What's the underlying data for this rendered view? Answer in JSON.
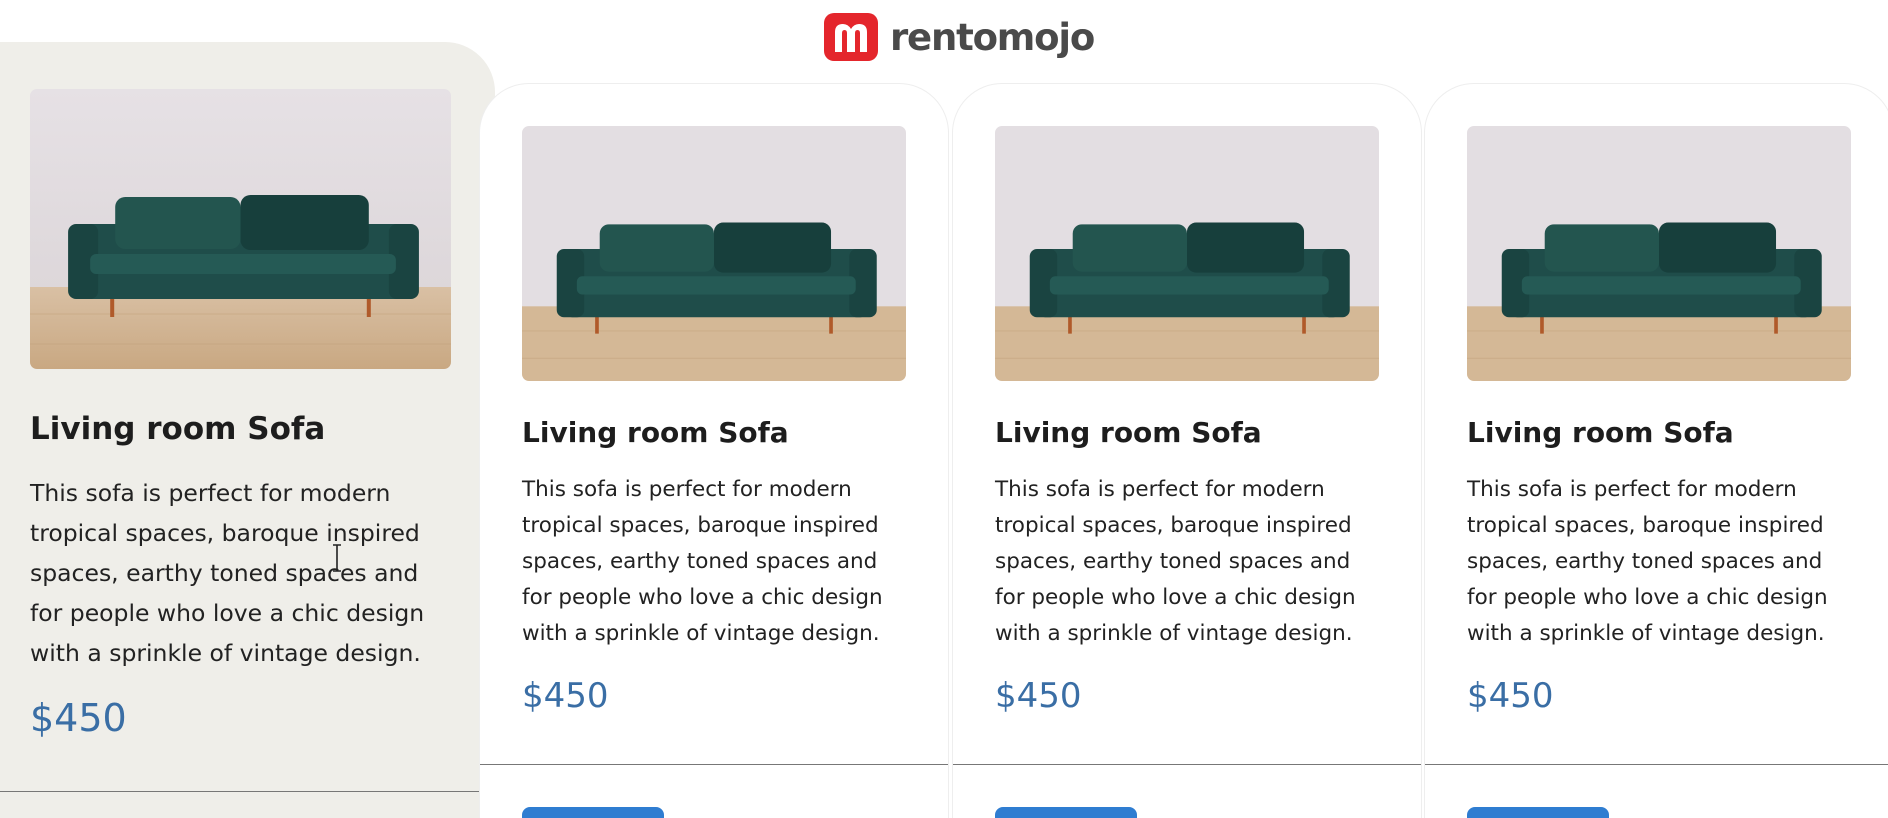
{
  "brand": {
    "logo_letter": "m",
    "name": "rentomojo",
    "color": "#e4262c"
  },
  "cards": [
    {
      "title": "Living room Sofa",
      "description": "This sofa is perfect for modern tropical spaces, baroque inspired spaces, earthy toned spaces and for people who love a chic design with a sprinkle of vintage design.",
      "price": "$450",
      "state": "hovered"
    },
    {
      "title": "Living room Sofa",
      "description": "This sofa is perfect for modern tropical spaces, baroque inspired spaces, earthy toned spaces and for people who love a chic design with a sprinkle of vintage design.",
      "price": "$450"
    },
    {
      "title": "Living room Sofa",
      "description": "This sofa is perfect for modern tropical spaces, baroque inspired spaces, earthy toned spaces and for people who love a chic design with a sprinkle of vintage design.",
      "price": "$450"
    },
    {
      "title": "Living room Sofa",
      "description": "This sofa is perfect for modern tropical spaces, baroque inspired spaces, earthy toned spaces and for people who love a chic design with a sprinkle of vintage design.",
      "price": "$450"
    }
  ],
  "colors": {
    "price": "#3a6ea5",
    "button": "#2f7dd1",
    "featured_background": "#efeee9",
    "sofa": "#1f4d4a"
  },
  "icons": {
    "product_image": "green-sofa-photo",
    "cursor": "text-cursor-icon"
  }
}
